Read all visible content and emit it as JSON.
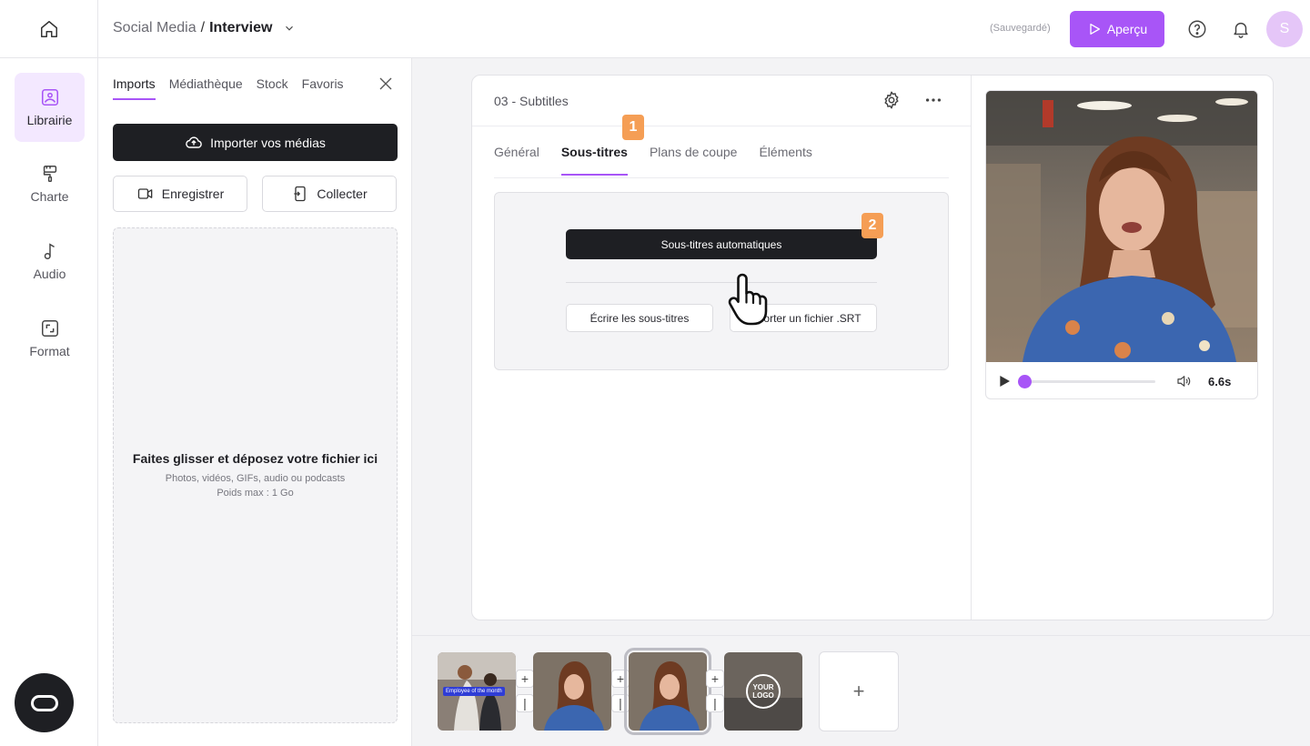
{
  "header": {
    "breadcrumb_parent": "Social Media",
    "breadcrumb_sep": "/",
    "breadcrumb_current": "Interview",
    "saved_status": "(Sauvegardé)",
    "preview_label": "Aperçu",
    "avatar_initial": "S"
  },
  "rail": {
    "items": [
      {
        "label": "Librairie",
        "icon": "image-icon",
        "active": true
      },
      {
        "label": "Charte",
        "icon": "paint-roller-icon",
        "active": false
      },
      {
        "label": "Audio",
        "icon": "music-note-icon",
        "active": false
      },
      {
        "label": "Format",
        "icon": "resize-icon",
        "active": false
      }
    ]
  },
  "library": {
    "tabs": [
      "Imports",
      "Médiathèque",
      "Stock",
      "Favoris"
    ],
    "active_tab": "Imports",
    "import_label": "Importer vos médias",
    "record_label": "Enregistrer",
    "collect_label": "Collecter",
    "dropzone_title": "Faites glisser et déposez votre fichier ici",
    "dropzone_types": "Photos, vidéos, GIFs, audio ou podcasts",
    "dropzone_limit": "Poids max : 1 Go"
  },
  "editor": {
    "title": "03 - Subtitles",
    "tabs": [
      "Général",
      "Sous-titres",
      "Plans de coupe",
      "Éléments"
    ],
    "active_tab": "Sous-titres",
    "step_badges": [
      "1",
      "2"
    ],
    "auto_subtitles_label": "Sous-titres automatiques",
    "write_subtitles_label": "Écrire les sous-titres",
    "import_srt_label": "Importer un fichier .SRT"
  },
  "player": {
    "duration": "6.6s",
    "progress": 0.02
  },
  "timeline": {
    "clips": [
      {
        "overlay_text": "Employee of the month",
        "selected": false
      },
      {
        "overlay_text": "",
        "selected": false
      },
      {
        "overlay_text": "",
        "selected": true
      },
      {
        "overlay_text": "YOUR LOGO",
        "selected": false
      }
    ],
    "add_label": "+"
  },
  "colors": {
    "accent": "#a855f7",
    "accent_light": "#f3e8ff",
    "dark": "#1e1f23",
    "badge": "#f59e55"
  }
}
